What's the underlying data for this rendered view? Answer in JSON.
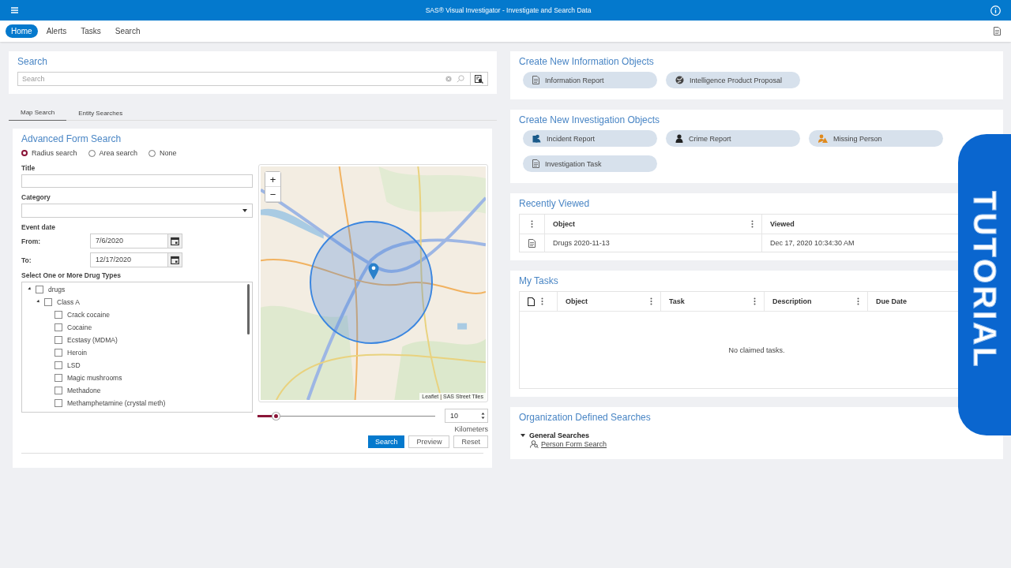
{
  "header": {
    "title": "SAS® Visual Investigator - Investigate and Search Data"
  },
  "nav": [
    {
      "label": "Home",
      "selected": true
    },
    {
      "label": "Alerts",
      "selected": false
    },
    {
      "label": "Tasks",
      "selected": false
    },
    {
      "label": "Search",
      "selected": false
    }
  ],
  "search_panel": {
    "title": "Search",
    "placeholder": "Search"
  },
  "search_tabs": [
    {
      "label": "Map Search",
      "selected": true
    },
    {
      "label": "Entity Searches",
      "selected": false
    }
  ],
  "advanced_form": {
    "title": "Advanced Form Search",
    "search_modes": [
      {
        "label": "Radius search",
        "selected": true
      },
      {
        "label": "Area search",
        "selected": false
      },
      {
        "label": "None",
        "selected": false
      }
    ],
    "title_field": {
      "label": "Title"
    },
    "category_field": {
      "label": "Category"
    },
    "event_date": {
      "label": "Event date",
      "from_label": "From:",
      "from": "7/6/2020",
      "to_label": "To:",
      "to": "12/17/2020"
    },
    "drug_types": {
      "label": "Select One or More Drug Types",
      "tree": [
        {
          "label": "drugs",
          "expanded": true,
          "checked": false,
          "children": [
            {
              "label": "Class A",
              "expanded": true,
              "checked": false,
              "children": [
                {
                  "label": "Crack cocaine",
                  "checked": false
                },
                {
                  "label": "Cocaine",
                  "checked": false
                },
                {
                  "label": "Ecstasy (MDMA)",
                  "checked": false
                },
                {
                  "label": "Heroin",
                  "checked": false
                },
                {
                  "label": "LSD",
                  "checked": false
                },
                {
                  "label": "Magic mushrooms",
                  "checked": false
                },
                {
                  "label": "Methadone",
                  "checked": false
                },
                {
                  "label": "Methamphetamine (crystal meth)",
                  "checked": false
                }
              ]
            }
          ]
        }
      ]
    },
    "map": {
      "kind": "picture",
      "zoom_in": "+",
      "zoom_out": "−",
      "attribution": "Leaflet | SAS Street Tiles"
    },
    "radius": {
      "level": 0.1,
      "value": "10",
      "unit": "Kilometers"
    },
    "buttons": [
      {
        "label": "Search",
        "kind": "primary"
      },
      {
        "label": "Preview",
        "kind": "secondary"
      },
      {
        "label": "Reset",
        "kind": "secondary"
      }
    ]
  },
  "info_objects": {
    "title": "Create New Information Objects",
    "items": [
      {
        "label": "Information Report",
        "kind": "document"
      },
      {
        "label": "Intelligence Product Proposal",
        "kind": "globe"
      }
    ]
  },
  "investigation_objects": {
    "title": "Create New Investigation Objects",
    "items": [
      {
        "label": "Incident Report",
        "kind": "incident"
      },
      {
        "label": "Crime Report",
        "kind": "crime"
      },
      {
        "label": "Missing Person",
        "kind": "missing"
      },
      {
        "label": "Investigation Task",
        "kind": "document"
      }
    ]
  },
  "recently_viewed": {
    "title": "Recently Viewed",
    "columns": [
      "Object",
      "Viewed"
    ],
    "rows": [
      {
        "object": "Drugs 2020-11-13",
        "viewed": "Dec 17, 2020 10:34:30 AM"
      }
    ]
  },
  "my_tasks": {
    "title": "My Tasks",
    "columns": [
      "Object",
      "Task",
      "Description",
      "Due Date"
    ],
    "empty": "No claimed tasks."
  },
  "org_searches": {
    "title": "Organization Defined Searches",
    "groups": [
      {
        "label": "General Searches",
        "expanded": true,
        "items": [
          "Person Form Search"
        ]
      }
    ]
  },
  "tutorial_tab": {
    "label": "TUTORIAL"
  }
}
